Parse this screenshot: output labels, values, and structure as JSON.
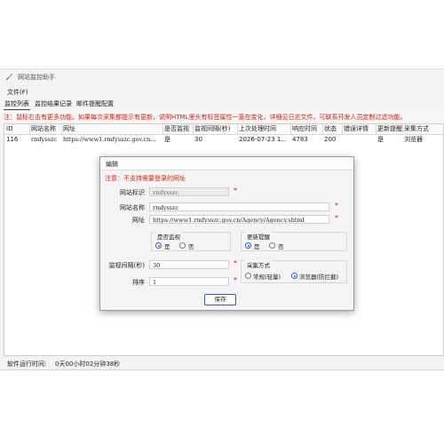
{
  "app": {
    "title": "网站监控助手",
    "menu": [
      "文件(F)"
    ],
    "tabs": [
      "监控列表",
      "监控结果记录",
      "邮件提醒配置"
    ],
    "notice": "注：鼠标右击有更多功能。如果每次采集都提示有更新，说明HTML里头有标签属性一直在变化，详细见日志文件。可联系开发人员定制过滤功能。",
    "columns": [
      "ID",
      "网站名称",
      "网址",
      "是否监视",
      "监视间隔(秒)",
      "上次处理时间",
      "响应时间",
      "状态",
      "错误详情",
      "更新提醒",
      "采集方式"
    ],
    "rows": [
      [
        "116",
        "rmfysszc",
        "https://www1.rmfysszc.gov.cn...",
        "是",
        "30",
        "2026-07-23 1...",
        "4783",
        "200",
        "",
        "是",
        "浏览器"
      ]
    ],
    "status_label": "软件运行时间:",
    "status_value": "0天00小时02分钟38秒"
  },
  "dialog": {
    "title": "编辑",
    "notice": "注意：不支持需要登录的网址",
    "site_id_label": "网站标识",
    "site_id_value": "rmfysszc",
    "site_name_label": "网站名称",
    "site_name_value": "rmfysszc",
    "url_label": "网址",
    "url_value": "https://www1.rmfysszc.gov.cn/Agency/Agency.shtml",
    "monitor_group": "是否监视",
    "monitor_yes": "是",
    "monitor_no": "否",
    "remind_group": "更新提醒",
    "remind_yes": "是",
    "remind_no": "否",
    "interval_label": "监视间隔(秒)",
    "interval_value": "30",
    "order_label": "排序",
    "order_value": "1",
    "collect_group": "采集方式",
    "collect_normal": "常规(轻量)",
    "collect_browser": "浏览器(防拦截)",
    "required_mark": "*",
    "save_label": "保存"
  }
}
